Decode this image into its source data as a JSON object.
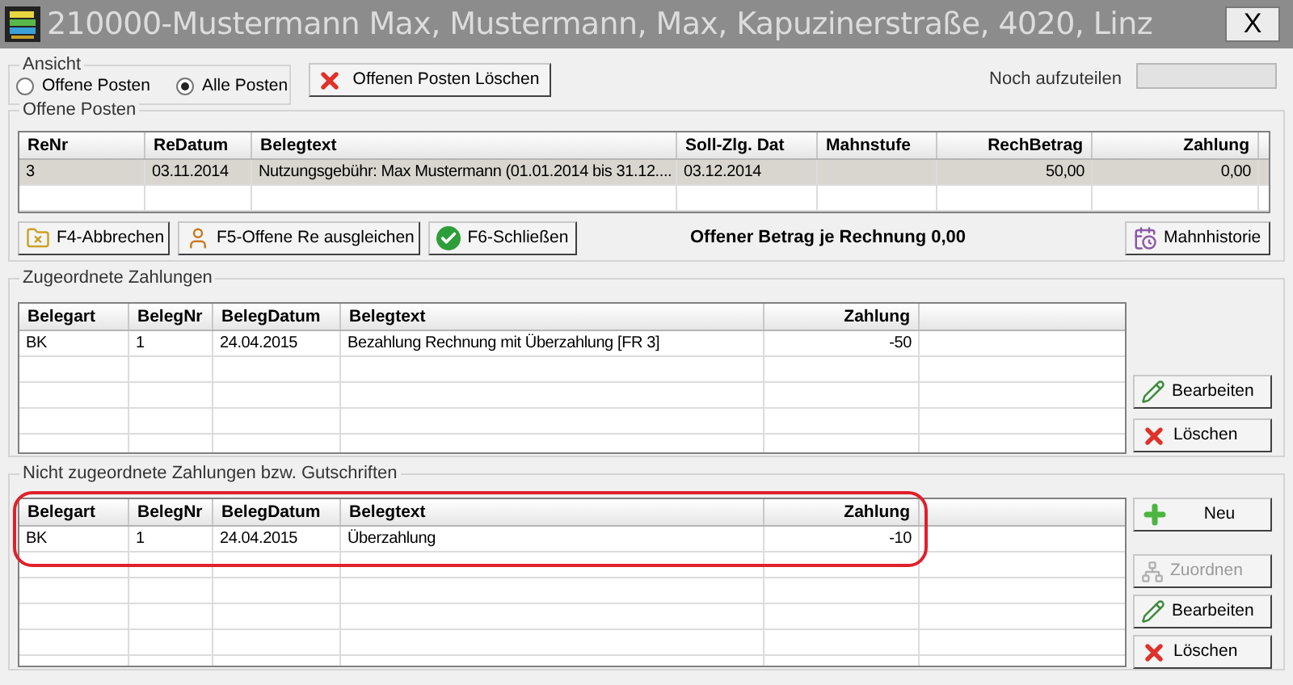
{
  "window": {
    "title": "210000-Mustermann Max, Mustermann, Max, Kapuzinerstraße, 4020, Linz",
    "close": "X"
  },
  "ansicht": {
    "label": "Ansicht",
    "options": [
      {
        "label": "Offene Posten",
        "selected": false
      },
      {
        "label": "Alle Posten",
        "selected": true
      }
    ]
  },
  "delete_open_button": {
    "label": "Offenen Posten Löschen",
    "kind": "delete"
  },
  "remaining": {
    "label": "Noch aufzuteilen"
  },
  "offene_posten": {
    "label": "Offene Posten",
    "table": {
      "columns": [
        "ReNr",
        "ReDatum",
        "Belegtext",
        "Soll-Zlg. Dat",
        "Mahnstufe",
        "RechBetrag",
        "Zahlung"
      ],
      "rows": [
        {
          "cells": [
            "3",
            "03.11.2014",
            "Nutzungsgebühr: Max Mustermann (01.01.2014 bis 31.12....",
            "03.12.2014",
            "",
            "50,00",
            "0,00"
          ],
          "selected": true
        }
      ]
    },
    "buttons": [
      {
        "label": "F4-Abbrechen",
        "kind": "cancel"
      },
      {
        "label": "F5-Offene Re ausgleichen",
        "kind": "person"
      },
      {
        "label": "F6-Schließen",
        "kind": "check"
      }
    ],
    "summary": "Offener Betrag je Rechnung 0,00",
    "history_button": {
      "label": "Mahnhistorie",
      "kind": "history"
    }
  },
  "zugeordnete": {
    "label": "Zugeordnete Zahlungen",
    "table": {
      "columns": [
        "Belegart",
        "BelegNr",
        "BelegDatum",
        "Belegtext",
        "Zahlung"
      ],
      "rows": [
        {
          "cells": [
            "BK",
            "1",
            "24.04.2015",
            "Bezahlung Rechnung mit Überzahlung [FR 3]",
            "-50"
          ],
          "selected": false
        }
      ]
    },
    "buttons": [
      {
        "label": "Bearbeiten",
        "kind": "edit",
        "disabled": false
      },
      {
        "label": "Löschen",
        "kind": "delete",
        "disabled": false
      }
    ]
  },
  "nicht_zugeordnete": {
    "label": "Nicht zugeordnete Zahlungen bzw. Gutschriften",
    "highlighted": true,
    "table": {
      "columns": [
        "Belegart",
        "BelegNr",
        "BelegDatum",
        "Belegtext",
        "Zahlung"
      ],
      "rows": [
        {
          "cells": [
            "BK",
            "1",
            "24.04.2015",
            "Überzahlung",
            "-10"
          ],
          "selected": false
        }
      ]
    },
    "buttons": [
      {
        "label": "Neu",
        "kind": "add",
        "disabled": false
      },
      {
        "label": "Zuordnen",
        "kind": "assign",
        "disabled": true
      },
      {
        "label": "Bearbeiten",
        "kind": "edit",
        "disabled": false
      },
      {
        "label": "Löschen",
        "kind": "delete",
        "disabled": false
      }
    ]
  }
}
